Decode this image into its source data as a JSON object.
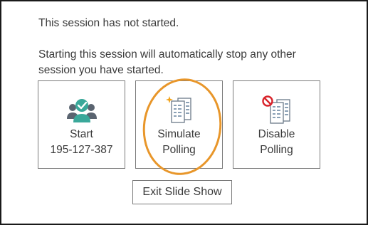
{
  "dialog": {
    "status_text": "This session has not started.",
    "warning_line1": "Starting this session will automatically stop any other",
    "warning_line2": "session you have started."
  },
  "tiles": [
    {
      "icon": "people-check-icon",
      "line1": "Start",
      "line2": "195-127-387"
    },
    {
      "icon": "simulate-polling-icon",
      "line1": "Simulate",
      "line2": "Polling"
    },
    {
      "icon": "disable-polling-icon",
      "line1": "Disable",
      "line2": "Polling"
    }
  ],
  "exit_button": {
    "label": "Exit Slide Show"
  },
  "colors": {
    "highlight": "#e8962a",
    "teal": "#3aa89a",
    "user_gray": "#5a6470",
    "no_red": "#d8232a"
  }
}
